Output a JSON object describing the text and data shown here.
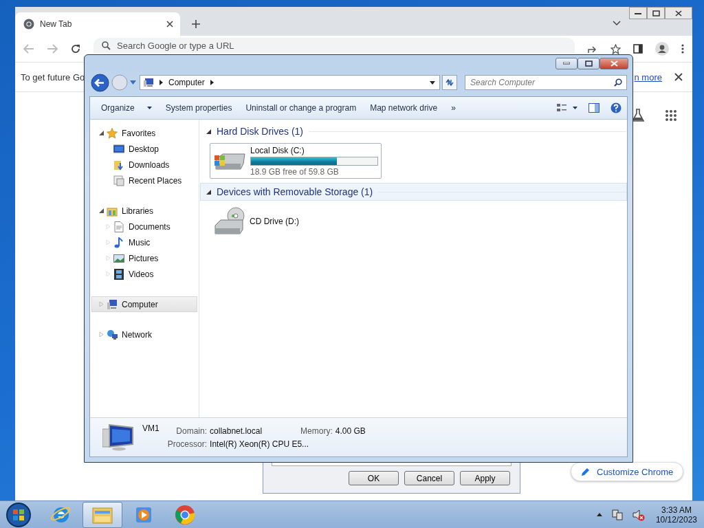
{
  "browser": {
    "tab": {
      "title": "New Tab"
    },
    "omnibox": {
      "placeholder": "Search Google or type a URL"
    },
    "infobar": {
      "text": "To get future Go",
      "link": "n more"
    },
    "customize_button": "Customize Chrome"
  },
  "dialog": {
    "buttons": [
      "OK",
      "Cancel",
      "Apply"
    ]
  },
  "explorer": {
    "address": [
      "Computer"
    ],
    "search": {
      "placeholder": "Search Computer"
    },
    "toolbar": [
      {
        "label": "Organize",
        "dropdown": true
      },
      {
        "label": "System properties",
        "dropdown": false
      },
      {
        "label": "Uninstall or change a program",
        "dropdown": false
      },
      {
        "label": "Map network drive",
        "dropdown": false
      },
      {
        "label": "»",
        "dropdown": false
      }
    ],
    "nav": [
      {
        "label": "Favorites",
        "kind": "star",
        "expanded": true,
        "selected": false,
        "children": [
          {
            "label": "Desktop",
            "kind": "desktop"
          },
          {
            "label": "Downloads",
            "kind": "downloads"
          },
          {
            "label": "Recent Places",
            "kind": "recent"
          }
        ]
      },
      {
        "label": "Libraries",
        "kind": "library",
        "expanded": true,
        "selected": false,
        "children": [
          {
            "label": "Documents",
            "kind": "document"
          },
          {
            "label": "Music",
            "kind": "music"
          },
          {
            "label": "Pictures",
            "kind": "pictures"
          },
          {
            "label": "Videos",
            "kind": "videos"
          }
        ]
      },
      {
        "label": "Computer",
        "kind": "computer",
        "expanded": false,
        "selected": true
      },
      {
        "label": "Network",
        "kind": "network",
        "expanded": false,
        "selected": false
      }
    ],
    "groups": [
      {
        "title": "Hard Disk Drives (1)",
        "hovered": false,
        "items": [
          {
            "kind": "disk",
            "name": "Local Disk (C:)",
            "level": 0.68,
            "caption": "18.9 GB free of 59.8 GB"
          }
        ]
      },
      {
        "title": "Devices with Removable Storage (1)",
        "hovered": true,
        "items": [
          {
            "kind": "cd",
            "name": "CD Drive (D:)"
          }
        ]
      }
    ],
    "details": {
      "name": "VM1",
      "fields": [
        {
          "label": "Domain:",
          "value": "collabnet.local"
        },
        {
          "label": "Memory:",
          "value": "4.00 GB"
        },
        {
          "label": "Processor:",
          "value": "Intel(R) Xeon(R) CPU E5..."
        }
      ]
    }
  },
  "taskbar": {
    "apps": [
      {
        "kind": "ie",
        "selected": false
      },
      {
        "kind": "explorer",
        "selected": true
      },
      {
        "kind": "media",
        "selected": false
      },
      {
        "kind": "chrome",
        "selected": false
      }
    ],
    "time": "3:33 AM",
    "date": "10/12/2023"
  }
}
